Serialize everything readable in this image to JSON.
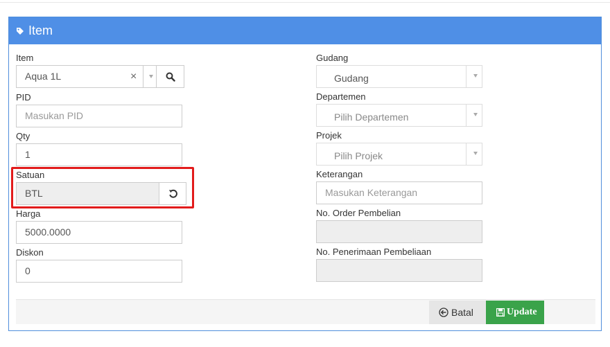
{
  "panel": {
    "title": "Item",
    "accent_color": "#4f8fe6"
  },
  "left": {
    "item": {
      "label": "Item",
      "value": "Aqua 1L",
      "clear": "×"
    },
    "pid": {
      "label": "PID",
      "placeholder": "Masukan PID"
    },
    "qty": {
      "label": "Qty",
      "value": "1"
    },
    "satuan": {
      "label": "Satuan",
      "value": "BTL"
    },
    "harga": {
      "label": "Harga",
      "value": "5000.0000"
    },
    "diskon": {
      "label": "Diskon",
      "value": "0"
    }
  },
  "right": {
    "gudang": {
      "label": "Gudang",
      "value": "Gudang"
    },
    "departemen": {
      "label": "Departemen",
      "placeholder": "Pilih Departemen"
    },
    "projek": {
      "label": "Projek",
      "placeholder": "Pilih Projek"
    },
    "keterangan": {
      "label": "Keterangan",
      "placeholder": "Masukan Keterangan"
    },
    "order": {
      "label": "No. Order Pembelian",
      "value": ""
    },
    "penerimaan": {
      "label": "No. Penerimaan Pembeliaan",
      "value": ""
    }
  },
  "footer": {
    "batal_label": "Batal",
    "update_label": "Update",
    "update_color": "#3aa34a"
  },
  "icons": {
    "title": "tag-icon",
    "search": "search-icon",
    "reset": "refresh-icon",
    "back": "back-arrow-icon",
    "save": "floppy-icon"
  }
}
